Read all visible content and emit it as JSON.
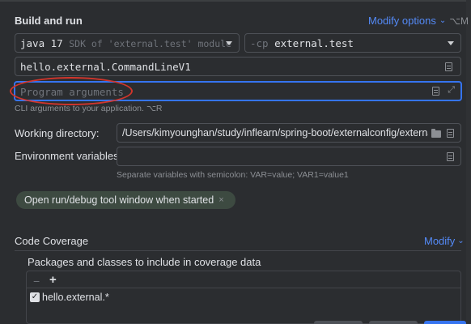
{
  "build_and_run": {
    "title": "Build and run",
    "modify_options": "Modify options",
    "modify_options_shortcut": "⌥M",
    "jdk": {
      "name": "java 17",
      "detail": "SDK of 'external.test' module"
    },
    "classpath": {
      "prefix": "-cp",
      "module": "external.test"
    },
    "main_class": "hello.external.CommandLineV1",
    "program_arguments_placeholder": "Program arguments",
    "cli_hint": "CLI arguments to your application. ⌥R"
  },
  "working_directory": {
    "label": "Working directory:",
    "value": "/Users/kimyounghan/study/inflearn/spring-boot/externalconfig/external"
  },
  "environment_variables": {
    "label": "Environment variables:",
    "value": "",
    "hint": "Separate variables with semicolon: VAR=value; VAR1=value1"
  },
  "chip": {
    "label": "Open run/debug tool window when started",
    "close_glyph": "×"
  },
  "code_coverage": {
    "title": "Code Coverage",
    "modify": "Modify",
    "packages_label": "Packages and classes to include in coverage data",
    "toolbar": {
      "remove_glyph": "−",
      "add_glyph": "+"
    },
    "items": [
      {
        "checked": true,
        "pattern": "hello.external.*"
      }
    ]
  },
  "icons": {
    "dropdown": "chevron-down-icon",
    "document": "document-icon",
    "expand": "expand-icon",
    "folder": "folder-icon",
    "checkbox": "checkmark-icon"
  },
  "colors": {
    "background": "#2b2d30",
    "accent": "#548af7",
    "focus_border": "#3574f0",
    "annotation_red": "#d2352b",
    "chip_bg": "#3d4a41"
  }
}
